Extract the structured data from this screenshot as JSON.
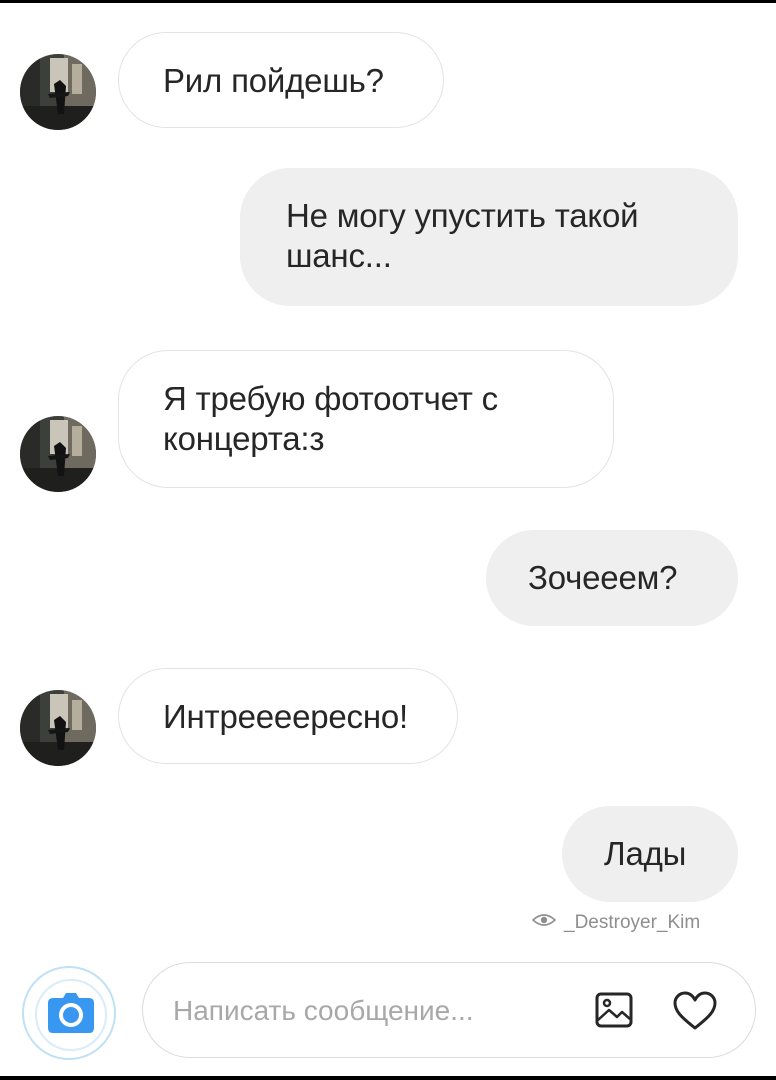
{
  "messages": [
    {
      "direction": "incoming",
      "lines": [
        "Рил пойдешь?"
      ]
    },
    {
      "direction": "outgoing",
      "lines": [
        "Не могу упустить такой",
        "шанс..."
      ]
    },
    {
      "direction": "incoming",
      "lines": [
        "Я требую фотоотчет с",
        "концерта:з"
      ]
    },
    {
      "direction": "outgoing",
      "lines": [
        "Зочееем?"
      ]
    },
    {
      "direction": "incoming",
      "lines": [
        "Интреееересно!"
      ]
    },
    {
      "direction": "outgoing",
      "lines": [
        "Лады"
      ]
    }
  ],
  "seen_by": {
    "icon": "eye-icon",
    "username": "_Destroyer_Kim"
  },
  "composer": {
    "placeholder": "Написать сообщение...",
    "value": "",
    "camera_icon": "camera-icon",
    "gallery_icon": "image-icon",
    "like_icon": "heart-icon"
  },
  "colors": {
    "outgoing_bubble": "#efefef",
    "incoming_border": "#e3e3e3",
    "camera_button": "#3897f0",
    "text": "#262626",
    "muted": "#8e8e8e"
  }
}
